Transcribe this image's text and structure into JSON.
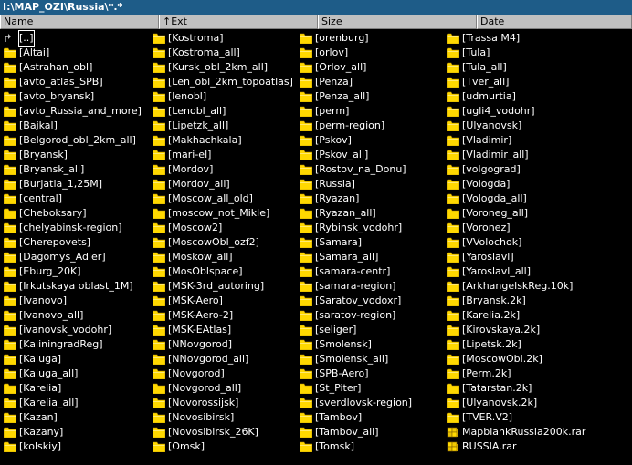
{
  "path": "I:\\MAP_OZI\\Russia\\*.*",
  "columns": {
    "name": "Name",
    "ext": "↑Ext",
    "size": "Size",
    "date": "Date"
  },
  "files": [
    {
      "label": "[..]",
      "type": "up"
    },
    {
      "label": "[Altai]",
      "type": "folder"
    },
    {
      "label": "[Astrahan_obl]",
      "type": "folder"
    },
    {
      "label": "[avto_atlas_SPB]",
      "type": "folder"
    },
    {
      "label": "[avto_bryansk]",
      "type": "folder"
    },
    {
      "label": "[avto_Russia_and_more]",
      "type": "folder"
    },
    {
      "label": "[Bajkal]",
      "type": "folder"
    },
    {
      "label": "[Belgorod_obl_2km_all]",
      "type": "folder"
    },
    {
      "label": "[Bryansk]",
      "type": "folder"
    },
    {
      "label": "[Bryansk_all]",
      "type": "folder"
    },
    {
      "label": "[Burjatia_1,25M]",
      "type": "folder"
    },
    {
      "label": "[central]",
      "type": "folder"
    },
    {
      "label": "[Cheboksary]",
      "type": "folder"
    },
    {
      "label": "[chelyabinsk-region]",
      "type": "folder"
    },
    {
      "label": "[Cherepovets]",
      "type": "folder"
    },
    {
      "label": "[Dagomys_Adler]",
      "type": "folder"
    },
    {
      "label": "[Eburg_20K]",
      "type": "folder"
    },
    {
      "label": "[Irkutskaya oblast_1M]",
      "type": "folder"
    },
    {
      "label": "[Ivanovo]",
      "type": "folder"
    },
    {
      "label": "[Ivanovo_all]",
      "type": "folder"
    },
    {
      "label": "[ivanovsk_vodohr]",
      "type": "folder"
    },
    {
      "label": "[KaliningradReg]",
      "type": "folder"
    },
    {
      "label": "[Kaluga]",
      "type": "folder"
    },
    {
      "label": "[Kaluga_all]",
      "type": "folder"
    },
    {
      "label": "[Karelia]",
      "type": "folder"
    },
    {
      "label": "[Karelia_all]",
      "type": "folder"
    },
    {
      "label": "[Kazan]",
      "type": "folder"
    },
    {
      "label": "[Kazany]",
      "type": "folder"
    },
    {
      "label": "[kolskiy]",
      "type": "folder"
    },
    {
      "label": "[Kostroma]",
      "type": "folder"
    },
    {
      "label": "[Kostroma_all]",
      "type": "folder"
    },
    {
      "label": "[Kursk_obl_2km_all]",
      "type": "folder"
    },
    {
      "label": "[Len_obl_2km_topoatlas]",
      "type": "folder"
    },
    {
      "label": "[lenobl]",
      "type": "folder"
    },
    {
      "label": "[Lenobl_all]",
      "type": "folder"
    },
    {
      "label": "[Lipetzk_all]",
      "type": "folder"
    },
    {
      "label": "[Makhachkala]",
      "type": "folder"
    },
    {
      "label": "[mari-el]",
      "type": "folder"
    },
    {
      "label": "[Mordov]",
      "type": "folder"
    },
    {
      "label": "[Mordov_all]",
      "type": "folder"
    },
    {
      "label": "[Moscow_all_old]",
      "type": "folder"
    },
    {
      "label": "[moscow_not_Mikle]",
      "type": "folder"
    },
    {
      "label": "[Moscow2]",
      "type": "folder"
    },
    {
      "label": "[MoscowObl_ozf2]",
      "type": "folder"
    },
    {
      "label": "[Moskow_all]",
      "type": "folder"
    },
    {
      "label": "[MosOblspace]",
      "type": "folder"
    },
    {
      "label": "[MSK-3rd_autoring]",
      "type": "folder"
    },
    {
      "label": "[MSK-Aero]",
      "type": "folder"
    },
    {
      "label": "[MSK-Aero-2]",
      "type": "folder"
    },
    {
      "label": "[MSK-EAtlas]",
      "type": "folder"
    },
    {
      "label": "[NNovgorod]",
      "type": "folder"
    },
    {
      "label": "[NNovgorod_all]",
      "type": "folder"
    },
    {
      "label": "[Novgorod]",
      "type": "folder"
    },
    {
      "label": "[Novgorod_all]",
      "type": "folder"
    },
    {
      "label": "[Novorossijsk]",
      "type": "folder"
    },
    {
      "label": "[Novosibirsk]",
      "type": "folder"
    },
    {
      "label": "[Novosibirsk_26K]",
      "type": "folder"
    },
    {
      "label": "[Omsk]",
      "type": "folder"
    },
    {
      "label": "[orenburg]",
      "type": "folder"
    },
    {
      "label": "[orlov]",
      "type": "folder"
    },
    {
      "label": "[Orlov_all]",
      "type": "folder"
    },
    {
      "label": "[Penza]",
      "type": "folder"
    },
    {
      "label": "[Penza_all]",
      "type": "folder"
    },
    {
      "label": "[perm]",
      "type": "folder"
    },
    {
      "label": "[perm-region]",
      "type": "folder"
    },
    {
      "label": "[Pskov]",
      "type": "folder"
    },
    {
      "label": "[Pskov_all]",
      "type": "folder"
    },
    {
      "label": "[Rostov_na_Donu]",
      "type": "folder"
    },
    {
      "label": "[Russia]",
      "type": "folder"
    },
    {
      "label": "[Ryazan]",
      "type": "folder"
    },
    {
      "label": "[Ryazan_all]",
      "type": "folder"
    },
    {
      "label": "[Rybinsk_vodohr]",
      "type": "folder"
    },
    {
      "label": "[Samara]",
      "type": "folder"
    },
    {
      "label": "[Samara_all]",
      "type": "folder"
    },
    {
      "label": "[samara-centr]",
      "type": "folder"
    },
    {
      "label": "[samara-region]",
      "type": "folder"
    },
    {
      "label": "[Saratov_vodoxr]",
      "type": "folder"
    },
    {
      "label": "[saratov-region]",
      "type": "folder"
    },
    {
      "label": "[seliger]",
      "type": "folder"
    },
    {
      "label": "[Smolensk]",
      "type": "folder"
    },
    {
      "label": "[Smolensk_all]",
      "type": "folder"
    },
    {
      "label": "[SPB-Aero]",
      "type": "folder"
    },
    {
      "label": "[St_Piter]",
      "type": "folder"
    },
    {
      "label": "[sverdlovsk-region]",
      "type": "folder"
    },
    {
      "label": "[Tambov]",
      "type": "folder"
    },
    {
      "label": "[Tambov_all]",
      "type": "folder"
    },
    {
      "label": "[Tomsk]",
      "type": "folder"
    },
    {
      "label": "[Trassa M4]",
      "type": "folder"
    },
    {
      "label": "[Tula]",
      "type": "folder"
    },
    {
      "label": "[Tula_all]",
      "type": "folder"
    },
    {
      "label": "[Tver_all]",
      "type": "folder"
    },
    {
      "label": "[udmurtia]",
      "type": "folder"
    },
    {
      "label": "[ugli4_vodohr]",
      "type": "folder"
    },
    {
      "label": "[Ulyanovsk]",
      "type": "folder"
    },
    {
      "label": "[Vladimir]",
      "type": "folder"
    },
    {
      "label": "[Vladimir_all]",
      "type": "folder"
    },
    {
      "label": "[volgograd]",
      "type": "folder"
    },
    {
      "label": "[Vologda]",
      "type": "folder"
    },
    {
      "label": "[Vologda_all]",
      "type": "folder"
    },
    {
      "label": "[Voroneg_all]",
      "type": "folder"
    },
    {
      "label": "[Voronez]",
      "type": "folder"
    },
    {
      "label": "[VVolochok]",
      "type": "folder"
    },
    {
      "label": "[Yaroslavl]",
      "type": "folder"
    },
    {
      "label": "[Yaroslavl_all]",
      "type": "folder"
    },
    {
      "label": "[ArkhangelskReg.10k]",
      "type": "folder"
    },
    {
      "label": "[Bryansk.2k]",
      "type": "folder"
    },
    {
      "label": "[Karelia.2k]",
      "type": "folder"
    },
    {
      "label": "[Kirovskaya.2k]",
      "type": "folder"
    },
    {
      "label": "[Lipetsk.2k]",
      "type": "folder"
    },
    {
      "label": "[MoscowObl.2k]",
      "type": "folder"
    },
    {
      "label": "[Perm.2k]",
      "type": "folder"
    },
    {
      "label": "[Tatarstan.2k]",
      "type": "folder"
    },
    {
      "label": "[Ulyanovsk.2k]",
      "type": "folder"
    },
    {
      "label": "[TVER.V2]",
      "type": "folder"
    },
    {
      "label": "MapblankRussia200k.rar",
      "type": "archive"
    },
    {
      "label": "RUSSIA.rar",
      "type": "archive"
    }
  ],
  "colors": {
    "background": "#000000",
    "text": "#ffffff",
    "folder": "#ffd800",
    "pathbar": "#1e5c88",
    "header": "#c0c0c0"
  }
}
